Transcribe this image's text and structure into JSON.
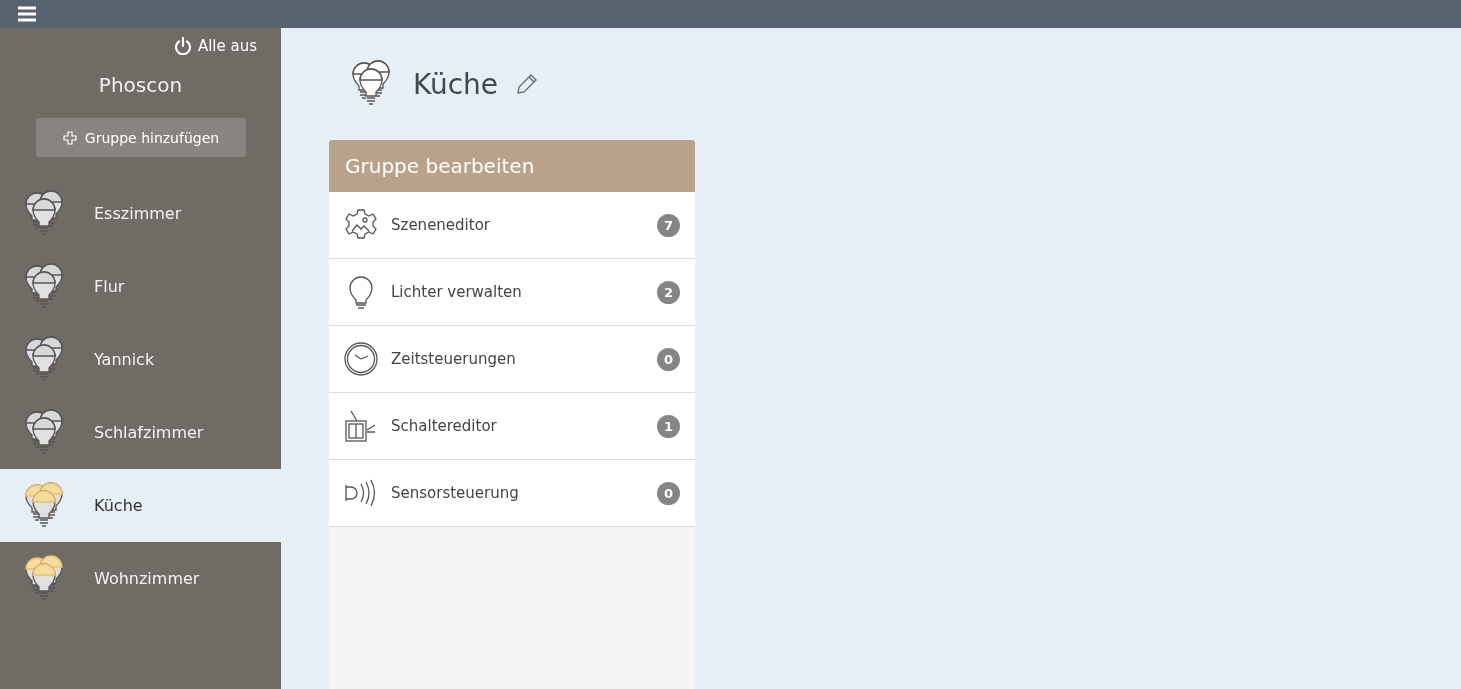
{
  "sidebar": {
    "all_off": "Alle aus",
    "title": "Phoscon",
    "add_button": "Gruppe hinzufügen",
    "groups": [
      {
        "name": "Esszimmer",
        "on": false,
        "selected": false
      },
      {
        "name": "Flur",
        "on": false,
        "selected": false
      },
      {
        "name": "Yannick",
        "on": false,
        "selected": false
      },
      {
        "name": "Schlafzimmer",
        "on": false,
        "selected": false
      },
      {
        "name": "Küche",
        "on": true,
        "selected": true
      },
      {
        "name": "Wohnzimmer",
        "on": true,
        "selected": false
      }
    ]
  },
  "page": {
    "title": "Küche"
  },
  "panel": {
    "title": "Gruppe bearbeiten",
    "items": [
      {
        "kind": "scenes",
        "label": "Szeneneditor",
        "count": "7"
      },
      {
        "kind": "lights",
        "label": "Lichter verwalten",
        "count": "2"
      },
      {
        "kind": "schedules",
        "label": "Zeitsteuerungen",
        "count": "0"
      },
      {
        "kind": "switches",
        "label": "Schaltereditor",
        "count": "1"
      },
      {
        "kind": "sensors",
        "label": "Sensorsteuerung",
        "count": "0"
      }
    ]
  }
}
